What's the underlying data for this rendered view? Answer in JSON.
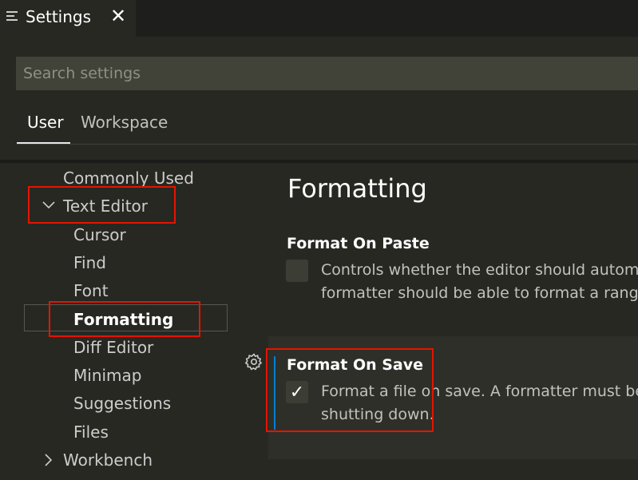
{
  "tab": {
    "title": "Settings",
    "close": "✕",
    "icon": "list-icon"
  },
  "search": {
    "placeholder": "Search settings",
    "value": ""
  },
  "scope_tabs": [
    {
      "label": "User",
      "active": true
    },
    {
      "label": "Workspace",
      "active": false
    }
  ],
  "toc": {
    "commonly_used": "Commonly Used",
    "text_editor": "Text Editor",
    "children": [
      "Cursor",
      "Find",
      "Font",
      "Formatting",
      "Diff Editor",
      "Minimap",
      "Suggestions",
      "Files"
    ],
    "workbench": "Workbench",
    "chevron_expanded": "∨",
    "chevron_collapsed": "›"
  },
  "content": {
    "section_title": "Formatting",
    "settings": [
      {
        "title": "Format On Paste",
        "checked": false,
        "desc_line1": "Controls whether the editor should automa",
        "desc_line2": "formatter should be able to format a range"
      },
      {
        "title": "Format On Save",
        "checked": true,
        "check_glyph": "✓",
        "desc_line1": "Format a file on save. A formatter must be a",
        "desc_line2": "shutting down."
      }
    ]
  },
  "colors": {
    "highlight_red": "#e51400",
    "focus_blue": "#007fd4",
    "background": "#272822"
  }
}
